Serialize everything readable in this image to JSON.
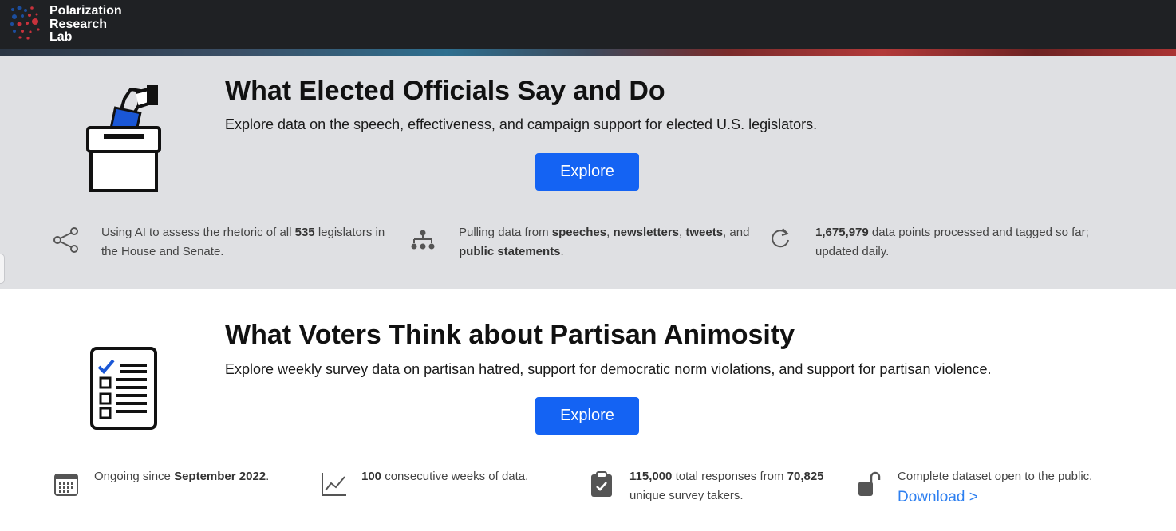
{
  "brand": {
    "name": "Polarization\nResearch\nLab",
    "colors": {
      "blue": "#1c4e9e",
      "red": "#c8323c"
    }
  },
  "section_officials": {
    "icon": "ballot-box-icon",
    "title": "What Elected Officials Say and Do",
    "description": "Explore data on the speech, effectiveness, and campaign support for elected U.S. legislators.",
    "button_label": "Explore",
    "stats": [
      {
        "icon": "share-icon",
        "pre": "Using AI to assess the rhetoric of all ",
        "b1": "535",
        "mid1": " legislators in the House and Senate.",
        "b2": "",
        "mid2": "",
        "b3": "",
        "mid3": "",
        "b4": "",
        "post": ""
      },
      {
        "icon": "hierarchy-icon",
        "pre": "Pulling data from ",
        "b1": "speeches",
        "mid1": ", ",
        "b2": "newsletters",
        "mid2": ", ",
        "b3": "tweets",
        "mid3": ", and ",
        "b4": "public statements",
        "post": "."
      },
      {
        "icon": "refresh-icon",
        "pre": "",
        "b1": "1,675,979",
        "mid1": " data points processed and tagged so far; updated daily.",
        "b2": "",
        "mid2": "",
        "b3": "",
        "mid3": "",
        "b4": "",
        "post": ""
      }
    ]
  },
  "section_voters": {
    "icon": "checklist-icon",
    "title": "What Voters Think about Partisan Animosity",
    "description": "Explore weekly survey data on partisan hatred, support for democratic norm violations, and support for partisan violence.",
    "button_label": "Explore",
    "stats": [
      {
        "icon": "calendar-icon",
        "pre": "Ongoing since ",
        "b1": "September 2022",
        "mid1": ".",
        "b2": "",
        "post": ""
      },
      {
        "icon": "line-chart-icon",
        "pre": "",
        "b1": "100",
        "mid1": " consecutive weeks of data.",
        "b2": "",
        "post": ""
      },
      {
        "icon": "clipboard-check-icon",
        "pre": "",
        "b1": "115,000",
        "mid1": " total responses from ",
        "b2": "70,825",
        "post": " unique survey takers."
      },
      {
        "icon": "unlock-icon",
        "pre": "Complete dataset open to the public.",
        "b1": "",
        "mid1": "",
        "b2": "",
        "post": "",
        "link": "Download >"
      }
    ]
  }
}
